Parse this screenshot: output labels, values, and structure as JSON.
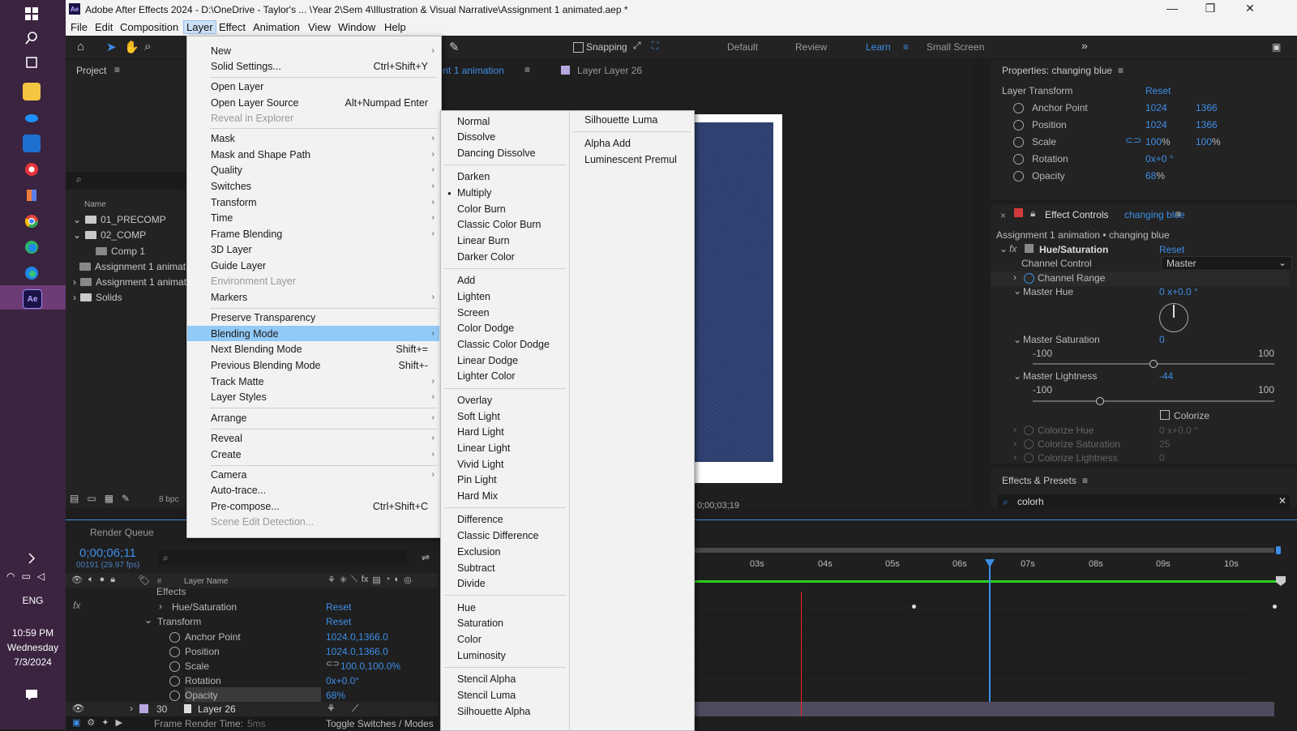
{
  "taskbar": {
    "time": "10:59 PM",
    "day": "Wednesday",
    "date": "7/3/2024",
    "lang": "ENG",
    "icons": [
      "windows-start-icon",
      "search-icon",
      "task-view-icon",
      "file-explorer-icon",
      "onedrive-icon",
      "outlook-icon",
      "app-red-icon",
      "app-multicolor-icon",
      "chrome-icon",
      "edge-icon",
      "edge-dev-icon",
      "after-effects-icon"
    ]
  },
  "titlebar": {
    "title": "Adobe After Effects 2024 - D:\\OneDrive - Taylor's ... \\Year 2\\Sem 4\\Illustration & Visual Narrative\\Assignment 1 animated.aep *",
    "app_icon": "Ae"
  },
  "menubar": [
    "File",
    "Edit",
    "Composition",
    "Layer",
    "Effect",
    "Animation",
    "View",
    "Window",
    "Help"
  ],
  "toolbar": {
    "snapping": "Snapping",
    "workspaces": [
      "Default",
      "Review",
      "Learn",
      "Small Screen"
    ]
  },
  "project": {
    "title": "Project",
    "column": "Name",
    "items": [
      "01_PRECOMP",
      "02_COMP",
      "Comp 1",
      "Assignment 1 animat",
      "Assignment 1 animat",
      "Solids"
    ],
    "bpc": "8 bpc"
  },
  "comp": {
    "tab": "nent 1 animation",
    "layer_tab": "Layer  Layer 26",
    "timecode": "0;00;03;19"
  },
  "layer_menu": {
    "items": [
      {
        "label": "New",
        "shortcut": "",
        "arrow": true,
        "disabled": false
      },
      {
        "label": "Solid Settings...",
        "shortcut": "Ctrl+Shift+Y",
        "arrow": false,
        "disabled": false
      },
      {
        "label": "Open Layer",
        "shortcut": "",
        "arrow": false,
        "disabled": false
      },
      {
        "label": "Open Layer Source",
        "shortcut": "Alt+Numpad Enter",
        "arrow": false,
        "disabled": false
      },
      {
        "label": "Reveal in Explorer",
        "shortcut": "",
        "arrow": false,
        "disabled": true
      },
      {
        "label": "Mask",
        "shortcut": "",
        "arrow": true,
        "disabled": false
      },
      {
        "label": "Mask and Shape Path",
        "shortcut": "",
        "arrow": true,
        "disabled": false
      },
      {
        "label": "Quality",
        "shortcut": "",
        "arrow": true,
        "disabled": false
      },
      {
        "label": "Switches",
        "shortcut": "",
        "arrow": true,
        "disabled": false
      },
      {
        "label": "Transform",
        "shortcut": "",
        "arrow": true,
        "disabled": false
      },
      {
        "label": "Time",
        "shortcut": "",
        "arrow": true,
        "disabled": false
      },
      {
        "label": "Frame Blending",
        "shortcut": "",
        "arrow": true,
        "disabled": false
      },
      {
        "label": "3D Layer",
        "shortcut": "",
        "arrow": false,
        "disabled": false
      },
      {
        "label": "Guide Layer",
        "shortcut": "",
        "arrow": false,
        "disabled": false
      },
      {
        "label": "Environment Layer",
        "shortcut": "",
        "arrow": false,
        "disabled": true
      },
      {
        "label": "Markers",
        "shortcut": "",
        "arrow": true,
        "disabled": false
      },
      {
        "label": "Preserve Transparency",
        "shortcut": "",
        "arrow": false,
        "disabled": false
      },
      {
        "label": "Blending Mode",
        "shortcut": "",
        "arrow": true,
        "disabled": false
      },
      {
        "label": "Next Blending Mode",
        "shortcut": "Shift+=",
        "arrow": false,
        "disabled": false
      },
      {
        "label": "Previous Blending Mode",
        "shortcut": "Shift+-",
        "arrow": false,
        "disabled": false
      },
      {
        "label": "Track Matte",
        "shortcut": "",
        "arrow": true,
        "disabled": false
      },
      {
        "label": "Layer Styles",
        "shortcut": "",
        "arrow": true,
        "disabled": false
      },
      {
        "label": "Arrange",
        "shortcut": "",
        "arrow": true,
        "disabled": false
      },
      {
        "label": "Reveal",
        "shortcut": "",
        "arrow": true,
        "disabled": false
      },
      {
        "label": "Create",
        "shortcut": "",
        "arrow": true,
        "disabled": false
      },
      {
        "label": "Camera",
        "shortcut": "",
        "arrow": true,
        "disabled": false
      },
      {
        "label": "Auto-trace...",
        "shortcut": "",
        "arrow": false,
        "disabled": false
      },
      {
        "label": "Pre-compose...",
        "shortcut": "Ctrl+Shift+C",
        "arrow": false,
        "disabled": false
      },
      {
        "label": "Scene Edit Detection...",
        "shortcut": "",
        "arrow": false,
        "disabled": true
      }
    ]
  },
  "blend_menu": {
    "col1": [
      "Normal",
      "Dissolve",
      "Dancing Dissolve",
      "Darken",
      "Multiply",
      "Color Burn",
      "Classic Color Burn",
      "Linear Burn",
      "Darker Color",
      "Add",
      "Lighten",
      "Screen",
      "Color Dodge",
      "Classic Color Dodge",
      "Linear Dodge",
      "Lighter Color",
      "Overlay",
      "Soft Light",
      "Hard Light",
      "Linear Light",
      "Vivid Light",
      "Pin Light",
      "Hard Mix",
      "Difference",
      "Classic Difference",
      "Exclusion",
      "Subtract",
      "Divide",
      "Hue",
      "Saturation",
      "Color",
      "Luminosity",
      "Stencil Alpha",
      "Stencil Luma",
      "Silhouette Alpha"
    ],
    "col2": [
      "Silhouette Luma",
      "Alpha Add",
      "Luminescent Premul"
    ],
    "checked": "Multiply"
  },
  "properties": {
    "title": "Properties: changing blue",
    "section": "Layer Transform",
    "reset": "Reset",
    "rows": [
      {
        "name": "Anchor Point",
        "v1": "1024",
        "v2": "1366",
        "unit": ""
      },
      {
        "name": "Position",
        "v1": "1024",
        "v2": "1366",
        "unit": ""
      },
      {
        "name": "Scale",
        "v1": "100",
        "v2": "100",
        "unit": "%"
      },
      {
        "name": "Rotation",
        "v1": "0",
        "v2": "",
        "unit": "x+0 °"
      },
      {
        "name": "Opacity",
        "v1": "68",
        "v2": "",
        "unit": "%"
      }
    ]
  },
  "effect_controls": {
    "title": "Effect Controls",
    "layer": "changing blue",
    "path": "Assignment 1 animation • changing blue",
    "effect": "Hue/Saturation",
    "reset": "Reset",
    "channel_control": "Channel Control",
    "channel_value": "Master",
    "channel_range": "Channel Range",
    "master_hue": "Master Hue",
    "master_hue_value": "0 x+0.0 °",
    "master_sat": "Master Saturation",
    "master_sat_value": "0",
    "master_light": "Master Lightness",
    "master_light_value": "-44",
    "min": "-100",
    "max": "100",
    "saturation_level": 0,
    "lightness_level": -44,
    "colorize": "Colorize",
    "colorize_hue": "Colorize Hue",
    "colorize_hue_value": "0 x+0.0 °",
    "colorize_sat": "Colorize Saturation",
    "colorize_sat_value": "25",
    "colorize_light": "Colorize Lightness",
    "colorize_light_value": "0"
  },
  "effects_presets": {
    "title": "Effects & Presets",
    "search": "colorh"
  },
  "timeline": {
    "render_queue": "Render Queue",
    "timecode": "0;00;06;11",
    "frames": "00191 (29.97 fps)",
    "layer_name_header": "Layer Name",
    "hash": "#",
    "effects": "Effects",
    "hue_sat": "Hue/Saturation",
    "reset": "Reset",
    "transform": "Transform",
    "props": [
      {
        "name": "Anchor Point",
        "value": "1024.0,1366.0"
      },
      {
        "name": "Position",
        "value": "1024.0,1366.0"
      },
      {
        "name": "Scale",
        "value": "100.0,100.0%"
      },
      {
        "name": "Rotation",
        "value": "0x+0.0°"
      },
      {
        "name": "Opacity",
        "value": "68%"
      }
    ],
    "layer_num": "30",
    "layer_name": "Layer 26",
    "render_time_label": "Frame Render Time:",
    "render_time": "5ms",
    "toggle": "Toggle Switches / Modes",
    "ruler": [
      "03s",
      "04s",
      "05s",
      "06s",
      "07s",
      "08s",
      "09s",
      "10s"
    ]
  }
}
